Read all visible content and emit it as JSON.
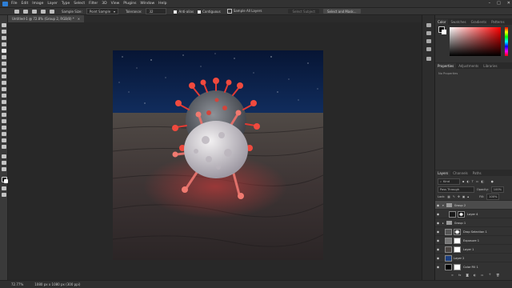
{
  "menubar": {
    "items": [
      "File",
      "Edit",
      "Image",
      "Layer",
      "Type",
      "Select",
      "Filter",
      "3D",
      "View",
      "Plugins",
      "Window",
      "Help"
    ],
    "window_controls": [
      "–",
      "□",
      "✕"
    ]
  },
  "options_bar": {
    "sample_size_label": "Sample Size:",
    "sample_size_value": "Point Sample",
    "tolerance_label": "Tolerance:",
    "tolerance_value": "32",
    "anti_alias_label": "Anti-alias",
    "contiguous_label": "Contiguous",
    "sample_all_layers_label": "Sample All Layers",
    "select_subject_label": "Select Subject",
    "select_and_mask_label": "Select and Mask..."
  },
  "document": {
    "tab_title": "Untitled-1 @ 72.8% (Group 2, RGB/8) *",
    "close_glyph": "×"
  },
  "status": {
    "zoom": "72.77%",
    "doc_size": "1080 px x 1080 px (300 ppi)"
  },
  "color_panel": {
    "tabs": [
      "Color",
      "Swatches",
      "Gradients",
      "Patterns"
    ],
    "accent_hex": "#ff0000"
  },
  "properties_panel": {
    "tabs": [
      "Properties",
      "Adjustments",
      "Libraries"
    ],
    "empty_text": "No Properties"
  },
  "layers_panel": {
    "tabs": [
      "Layers",
      "Channels",
      "Paths"
    ],
    "kind_label": "Kind",
    "blend_mode": "Pass Through",
    "opacity_label": "Opacity:",
    "opacity_value": "100%",
    "lock_label": "Lock:",
    "fill_label": "Fill:",
    "fill_value": "100%",
    "layers": [
      {
        "name": "Group 2",
        "type": "group",
        "selected": true
      },
      {
        "name": "Layer 4",
        "type": "layer",
        "selected": false
      },
      {
        "name": "Group 1",
        "type": "group",
        "selected": false
      },
      {
        "name": "Drop Selection 1",
        "type": "layer",
        "selected": false
      },
      {
        "name": "Exposure 1",
        "type": "adjustment",
        "selected": false
      },
      {
        "name": "Layer 1",
        "type": "layer",
        "selected": false
      },
      {
        "name": "Layer 2",
        "type": "layer",
        "selected": false
      },
      {
        "name": "Color Fill 1",
        "type": "fill",
        "selected": false
      }
    ]
  }
}
